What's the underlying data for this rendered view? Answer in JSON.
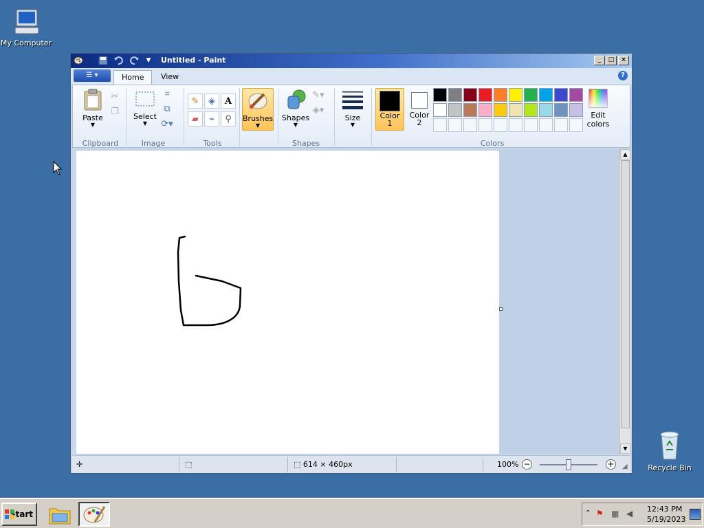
{
  "desktop": {
    "icons": [
      {
        "label": "My Computer"
      },
      {
        "label": "Recycle Bin"
      }
    ]
  },
  "window": {
    "title": "Untitled - Paint",
    "tabs": [
      {
        "label": "Home",
        "active": true
      },
      {
        "label": "View",
        "active": false
      }
    ],
    "help": "?"
  },
  "ribbon": {
    "clipboard": {
      "paste": "Paste",
      "group": "Clipboard"
    },
    "image": {
      "select": "Select",
      "group": "Image"
    },
    "tools": {
      "group": "Tools"
    },
    "brushes": {
      "label": "Brushes"
    },
    "shapes": {
      "label": "Shapes",
      "group": "Shapes"
    },
    "size": {
      "label": "Size"
    },
    "color1": {
      "label": "Color",
      "num": "1",
      "value": "#000000"
    },
    "color2": {
      "label": "Color",
      "num": "2",
      "value": "#ffffff"
    },
    "edit_colors": {
      "line1": "Edit",
      "line2": "colors"
    },
    "colors_group": "Colors",
    "palette_row1": [
      "#000000",
      "#7f7f7f",
      "#880015",
      "#ed1c24",
      "#ff7f27",
      "#fff200",
      "#22b14c",
      "#00a2e8",
      "#3f48cc",
      "#a349a4"
    ],
    "palette_row2": [
      "#ffffff",
      "#c3c3c3",
      "#b97a57",
      "#ffaec9",
      "#ffc90e",
      "#efe4b0",
      "#b5e61d",
      "#99d9ea",
      "#7092be",
      "#c8bfe7"
    ]
  },
  "status": {
    "canvas_size": "614 × 460px",
    "zoom": "100%"
  },
  "taskbar": {
    "start": "Start",
    "time": "12:43 PM",
    "date": "5/19/2023"
  }
}
